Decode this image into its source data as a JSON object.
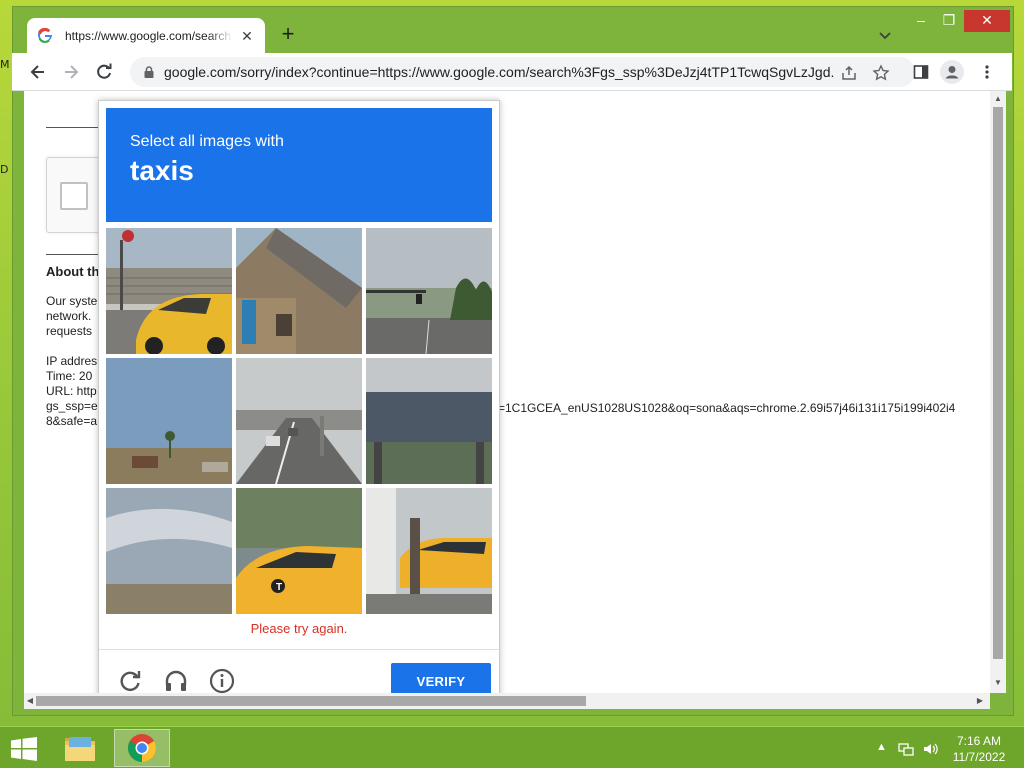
{
  "browser": {
    "tab_title": "https://www.google.com/search?gs_ssp",
    "new_tab_symbol": "+",
    "tab_close_symbol": "✕",
    "url": "google.com/sorry/index?continue=https://www.google.com/search%3Fgs_ssp%3DeJzj4tTP1TcwqSgvLzJgd...",
    "window_controls": {
      "minimize": "–",
      "maximize": "❐",
      "close": "✕"
    }
  },
  "page": {
    "heading_partial": "About th",
    "text_lines": [
      "Our syste",
      "network.",
      "requests"
    ],
    "info_lines": [
      "IP addres",
      "Time: 20",
      "URL: http",
      "gs_ssp=e",
      "8&safe=a"
    ],
    "url_overflow": "=1C1GCEA_enUS1028US1028&oq=sona&aqs=chrome.2.69i57j46i131i175i199i402i4"
  },
  "captcha": {
    "prompt_line1": "Select all images with",
    "prompt_target": "taxis",
    "error_text": "Please try again.",
    "verify_label": "VERIFY",
    "tiles": [
      "taxi-street-corner",
      "stone-church",
      "road-traffic-light",
      "palm-tree-lot",
      "highway-traffic",
      "overpass-bridge",
      "cloudy-sky",
      "taxi-closeup",
      "taxi-behind-pole"
    ],
    "colors": {
      "header": "#1a73e8",
      "error": "#d93025",
      "button": "#1a73e8"
    }
  },
  "taskbar": {
    "time": "7:16 AM",
    "date": "11/7/2022",
    "tray_arrow": "▲"
  },
  "desktop": {
    "edge_icon_1": "M",
    "edge_icon_2": "D"
  }
}
